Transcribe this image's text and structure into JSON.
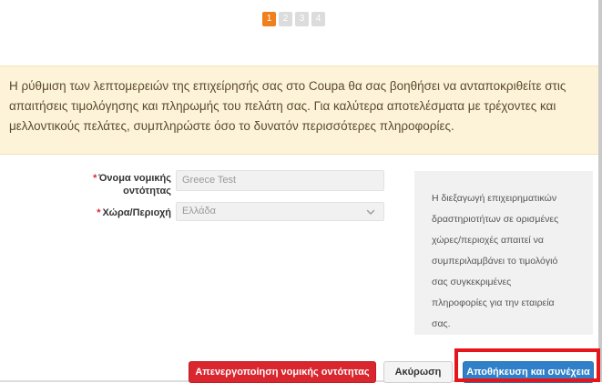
{
  "stepper": {
    "steps": [
      "1",
      "2",
      "3",
      "4"
    ],
    "active_step": 1,
    "active_color": "#f07f1d"
  },
  "banner": {
    "text": "Η ρύθμιση των λεπτομερειών της επιχείρησής σας στο Coupa θα σας βοηθήσει να ανταποκριθείτε στις απαιτήσεις τιμολόγησης και πληρωμής του πελάτη σας. Για καλύτερα αποτελέσματα με τρέχοντες και μελλοντικούς πελάτες, συμπληρώστε όσο το δυνατόν περισσότερες πληροφορίες."
  },
  "form": {
    "legal_name": {
      "required_mark": "*",
      "label_line1": "Όνομα νομικής",
      "label_line2": "οντότητας",
      "value": "Greece Test"
    },
    "country": {
      "required_mark": "*",
      "label": "Χώρα/Περιοχή",
      "value": "Ελλάδα",
      "icon": "chevron-down-icon"
    }
  },
  "sidebox": {
    "lines": [
      "Η διεξαγωγή επιχειρηματικών",
      "δραστηριοτήτων σε ορισμένες",
      "χώρες/περιοχές απαιτεί να",
      "συμπεριλαμβάνει το τιμολόγιό",
      "σας συγκεκριμένες",
      "πληροφορίες για την εταιρεία",
      "σας."
    ]
  },
  "footer": {
    "deactivate_label": "Απενεργοποίηση νομικής οντότητας",
    "cancel_label": "Ακύρωση",
    "save_label": "Αποθήκευση και συνέχεια",
    "colors": {
      "deactivate": "#d9262f",
      "save": "#2f80c8",
      "highlight": "#e5151c"
    }
  }
}
